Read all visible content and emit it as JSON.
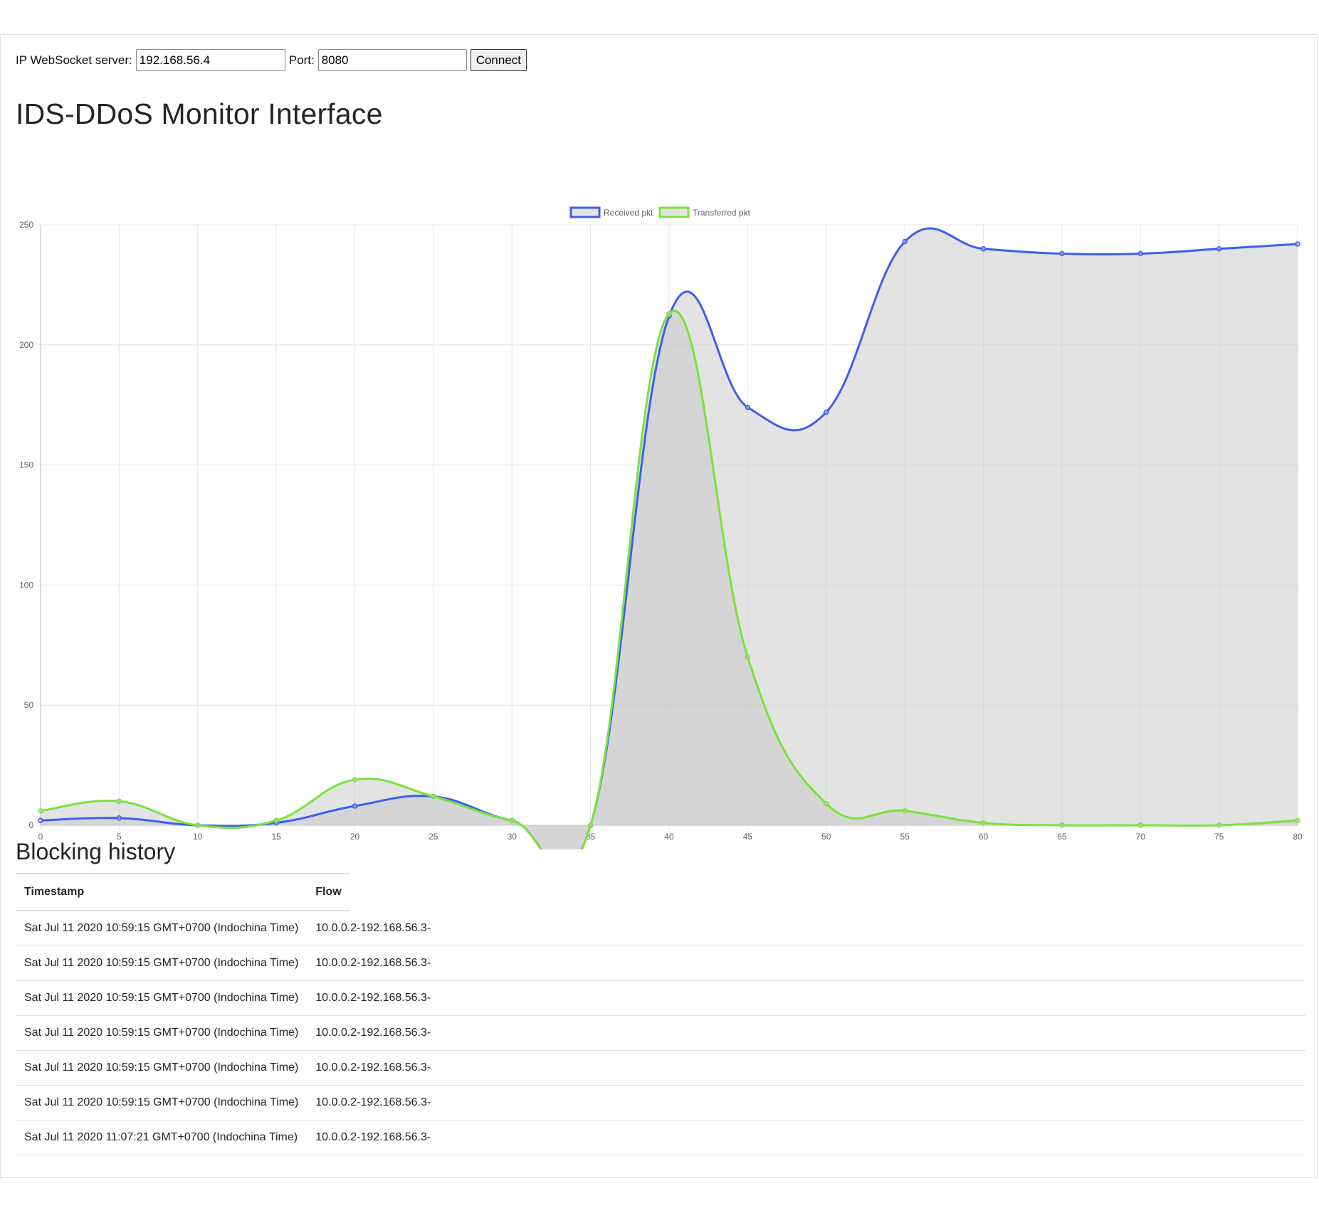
{
  "connection": {
    "ip_label": "IP WebSocket server:",
    "ip_value": "192.168.56.4",
    "port_label": "Port:",
    "port_value": "8080",
    "connect_label": "Connect"
  },
  "page_title": "IDS-DDoS Monitor Interface",
  "chart_data": {
    "type": "line",
    "x": [
      0,
      5,
      10,
      15,
      20,
      25,
      30,
      35,
      40,
      45,
      50,
      55,
      60,
      65,
      70,
      75,
      80
    ],
    "series": [
      {
        "name": "Received pkt",
        "color": "#3d5ef0",
        "fill": "rgba(200,200,200,0.5)",
        "values": [
          2,
          3,
          0,
          1,
          8,
          12,
          2,
          0,
          212,
          174,
          172,
          243,
          240,
          238,
          238,
          240,
          242
        ]
      },
      {
        "name": "Transferred pkt",
        "color": "#78e33c",
        "fill": "rgba(200,200,200,0.5)",
        "values": [
          6,
          10,
          0,
          2,
          19,
          12,
          2,
          0,
          213,
          70,
          9,
          6,
          1,
          0,
          0,
          0,
          2
        ]
      }
    ],
    "ylim": [
      0,
      250
    ],
    "yticks": [
      0,
      50,
      100,
      150,
      200,
      250
    ],
    "xticks": [
      0,
      5,
      10,
      15,
      20,
      25,
      30,
      35,
      40,
      45,
      50,
      55,
      60,
      65,
      70,
      75,
      80
    ],
    "grid": true,
    "legend": "top-center"
  },
  "history": {
    "title": "Blocking history",
    "columns": [
      "Timestamp",
      "Flow"
    ],
    "rows": [
      {
        "timestamp": "Sat Jul 11 2020 10:59:15 GMT+0700 (Indochina Time)",
        "flow": "10.0.0.2-192.168.56.3-"
      },
      {
        "timestamp": "Sat Jul 11 2020 10:59:15 GMT+0700 (Indochina Time)",
        "flow": "10.0.0.2-192.168.56.3-"
      },
      {
        "timestamp": "Sat Jul 11 2020 10:59:15 GMT+0700 (Indochina Time)",
        "flow": "10.0.0.2-192.168.56.3-"
      },
      {
        "timestamp": "Sat Jul 11 2020 10:59:15 GMT+0700 (Indochina Time)",
        "flow": "10.0.0.2-192.168.56.3-"
      },
      {
        "timestamp": "Sat Jul 11 2020 10:59:15 GMT+0700 (Indochina Time)",
        "flow": "10.0.0.2-192.168.56.3-"
      },
      {
        "timestamp": "Sat Jul 11 2020 10:59:15 GMT+0700 (Indochina Time)",
        "flow": "10.0.0.2-192.168.56.3-"
      },
      {
        "timestamp": "Sat Jul 11 2020 11:07:21 GMT+0700 (Indochina Time)",
        "flow": "10.0.0.2-192.168.56.3-"
      }
    ]
  }
}
